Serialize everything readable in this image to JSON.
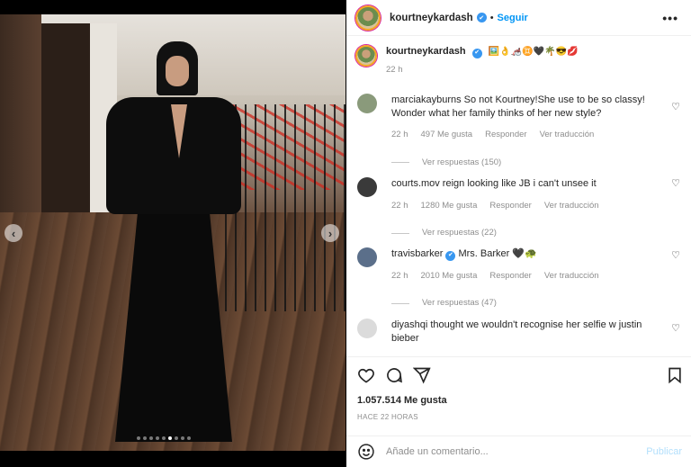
{
  "post": {
    "author": "kourtneykardash",
    "follow_label": "Seguir",
    "separator": "•",
    "more_label": "•••",
    "caption_emojis": "🖼️👌🦽♊🖤🌴😎💋",
    "caption_time": "22 h",
    "photo_count": 9,
    "active_photo_index": 5
  },
  "comments": [
    {
      "user": "marciakayburns",
      "text": "So not Kourtney!She use to be so classy! Wonder what her family thinks of her new style?",
      "time": "22 h",
      "likes": "497 Me gusta",
      "reply": "Responder",
      "translate": "Ver traducción",
      "replies": "Ver respuestas (150)",
      "avatar_color": "#8a9a7b"
    },
    {
      "user": "courts.mov",
      "text": "reign looking like JB i can't unsee it",
      "time": "22 h",
      "likes": "1280 Me gusta",
      "reply": "Responder",
      "translate": "Ver traducción",
      "replies": "Ver respuestas (22)",
      "avatar_color": "#3a3a3a"
    },
    {
      "user": "travisbarker",
      "text": "Mrs. Barker 🖤🐢",
      "time": "22 h",
      "likes": "2010 Me gusta",
      "reply": "Responder",
      "translate": "Ver traducción",
      "replies": "Ver respuestas (47)",
      "avatar_color": "#5b6f8a"
    },
    {
      "user": "diyashqi",
      "text": "thought we wouldn't recognise her selfie w justin bieber",
      "avatar_color": "#dbdbdb"
    }
  ],
  "footer": {
    "likes": "1.057.514 Me gusta",
    "ago": "HACE 22 HORAS",
    "comment_placeholder": "Añade un comentario...",
    "publish_label": "Publicar"
  },
  "colors": {
    "link_blue": "#0095f6",
    "publish_disabled": "#b2dffc",
    "muted": "#8e8e8e"
  },
  "icons": [
    "heart-icon",
    "comment-icon",
    "share-icon",
    "bookmark-icon",
    "emoji-icon",
    "chevron-left-icon",
    "chevron-right-icon",
    "verified-icon"
  ]
}
